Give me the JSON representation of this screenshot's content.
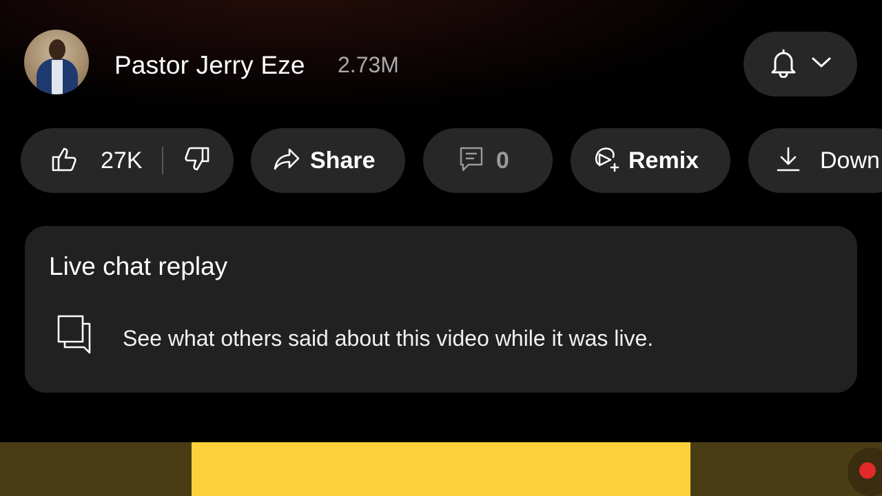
{
  "channel": {
    "name": "Pastor Jerry Eze",
    "subscribers": "2.73M",
    "notification_icon": "bell-icon"
  },
  "actions": {
    "like_count": "27K",
    "share_label": "Share",
    "comments_count": "0",
    "remix_label": "Remix",
    "download_label": "Down"
  },
  "live_chat": {
    "title": "Live chat replay",
    "description": "See what others said about this video while it was live."
  },
  "colors": {
    "pill_bg": "#272727",
    "card_bg": "#212121",
    "accent_yellow": "#fcd23c",
    "live_red": "#e22a2a"
  }
}
